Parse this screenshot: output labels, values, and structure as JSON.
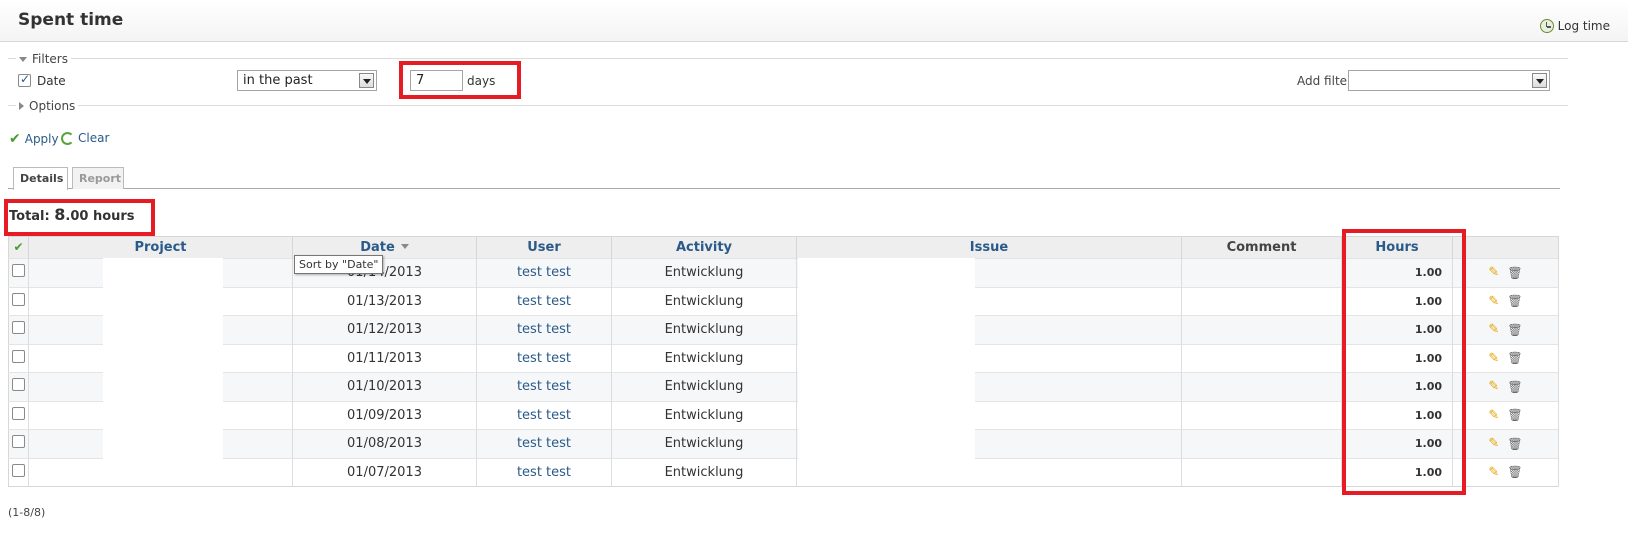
{
  "header": {
    "title": "Spent time",
    "log_time_label": "Log time"
  },
  "filters": {
    "legend": "Filters",
    "date_label": "Date",
    "operator": "in the past",
    "value": "7",
    "unit": "days",
    "add_filter_label": "Add filter",
    "add_filter_value": ""
  },
  "options": {
    "legend": "Options"
  },
  "actions": {
    "apply": "Apply",
    "clear": "Clear"
  },
  "tabs": [
    {
      "label": "Details",
      "active": true
    },
    {
      "label": "Report",
      "active": false
    }
  ],
  "total": {
    "prefix": "Total: ",
    "big": "8",
    "rest": ".00 hours"
  },
  "table": {
    "columns": [
      "Project",
      "Date",
      "User",
      "Activity",
      "Issue",
      "Comment",
      "Hours"
    ],
    "rows": [
      {
        "project": "",
        "date": "01/14/2013",
        "user": "test test",
        "activity": "Entwicklung",
        "issue": "",
        "comment": "",
        "hours": "1.00"
      },
      {
        "project": "",
        "date": "01/13/2013",
        "user": "test test",
        "activity": "Entwicklung",
        "issue": "",
        "comment": "",
        "hours": "1.00"
      },
      {
        "project": "",
        "date": "01/12/2013",
        "user": "test test",
        "activity": "Entwicklung",
        "issue": "",
        "comment": "",
        "hours": "1.00"
      },
      {
        "project": "",
        "date": "01/11/2013",
        "user": "test test",
        "activity": "Entwicklung",
        "issue": "",
        "comment": "",
        "hours": "1.00"
      },
      {
        "project": "",
        "date": "01/10/2013",
        "user": "test test",
        "activity": "Entwicklung",
        "issue": "",
        "comment": "",
        "hours": "1.00"
      },
      {
        "project": "",
        "date": "01/09/2013",
        "user": "test test",
        "activity": "Entwicklung",
        "issue": "",
        "comment": "",
        "hours": "1.00"
      },
      {
        "project": "",
        "date": "01/08/2013",
        "user": "test test",
        "activity": "Entwicklung",
        "issue": "",
        "comment": "",
        "hours": "1.00"
      },
      {
        "project": "",
        "date": "01/07/2013",
        "user": "test test",
        "activity": "Entwicklung",
        "issue": "",
        "comment": "",
        "hours": "1.00"
      }
    ]
  },
  "tooltip": "Sort by \"Date\"",
  "pagination": "(1-8/8)",
  "colors": {
    "highlight": "#e51c23",
    "link": "#2a5a8a"
  }
}
